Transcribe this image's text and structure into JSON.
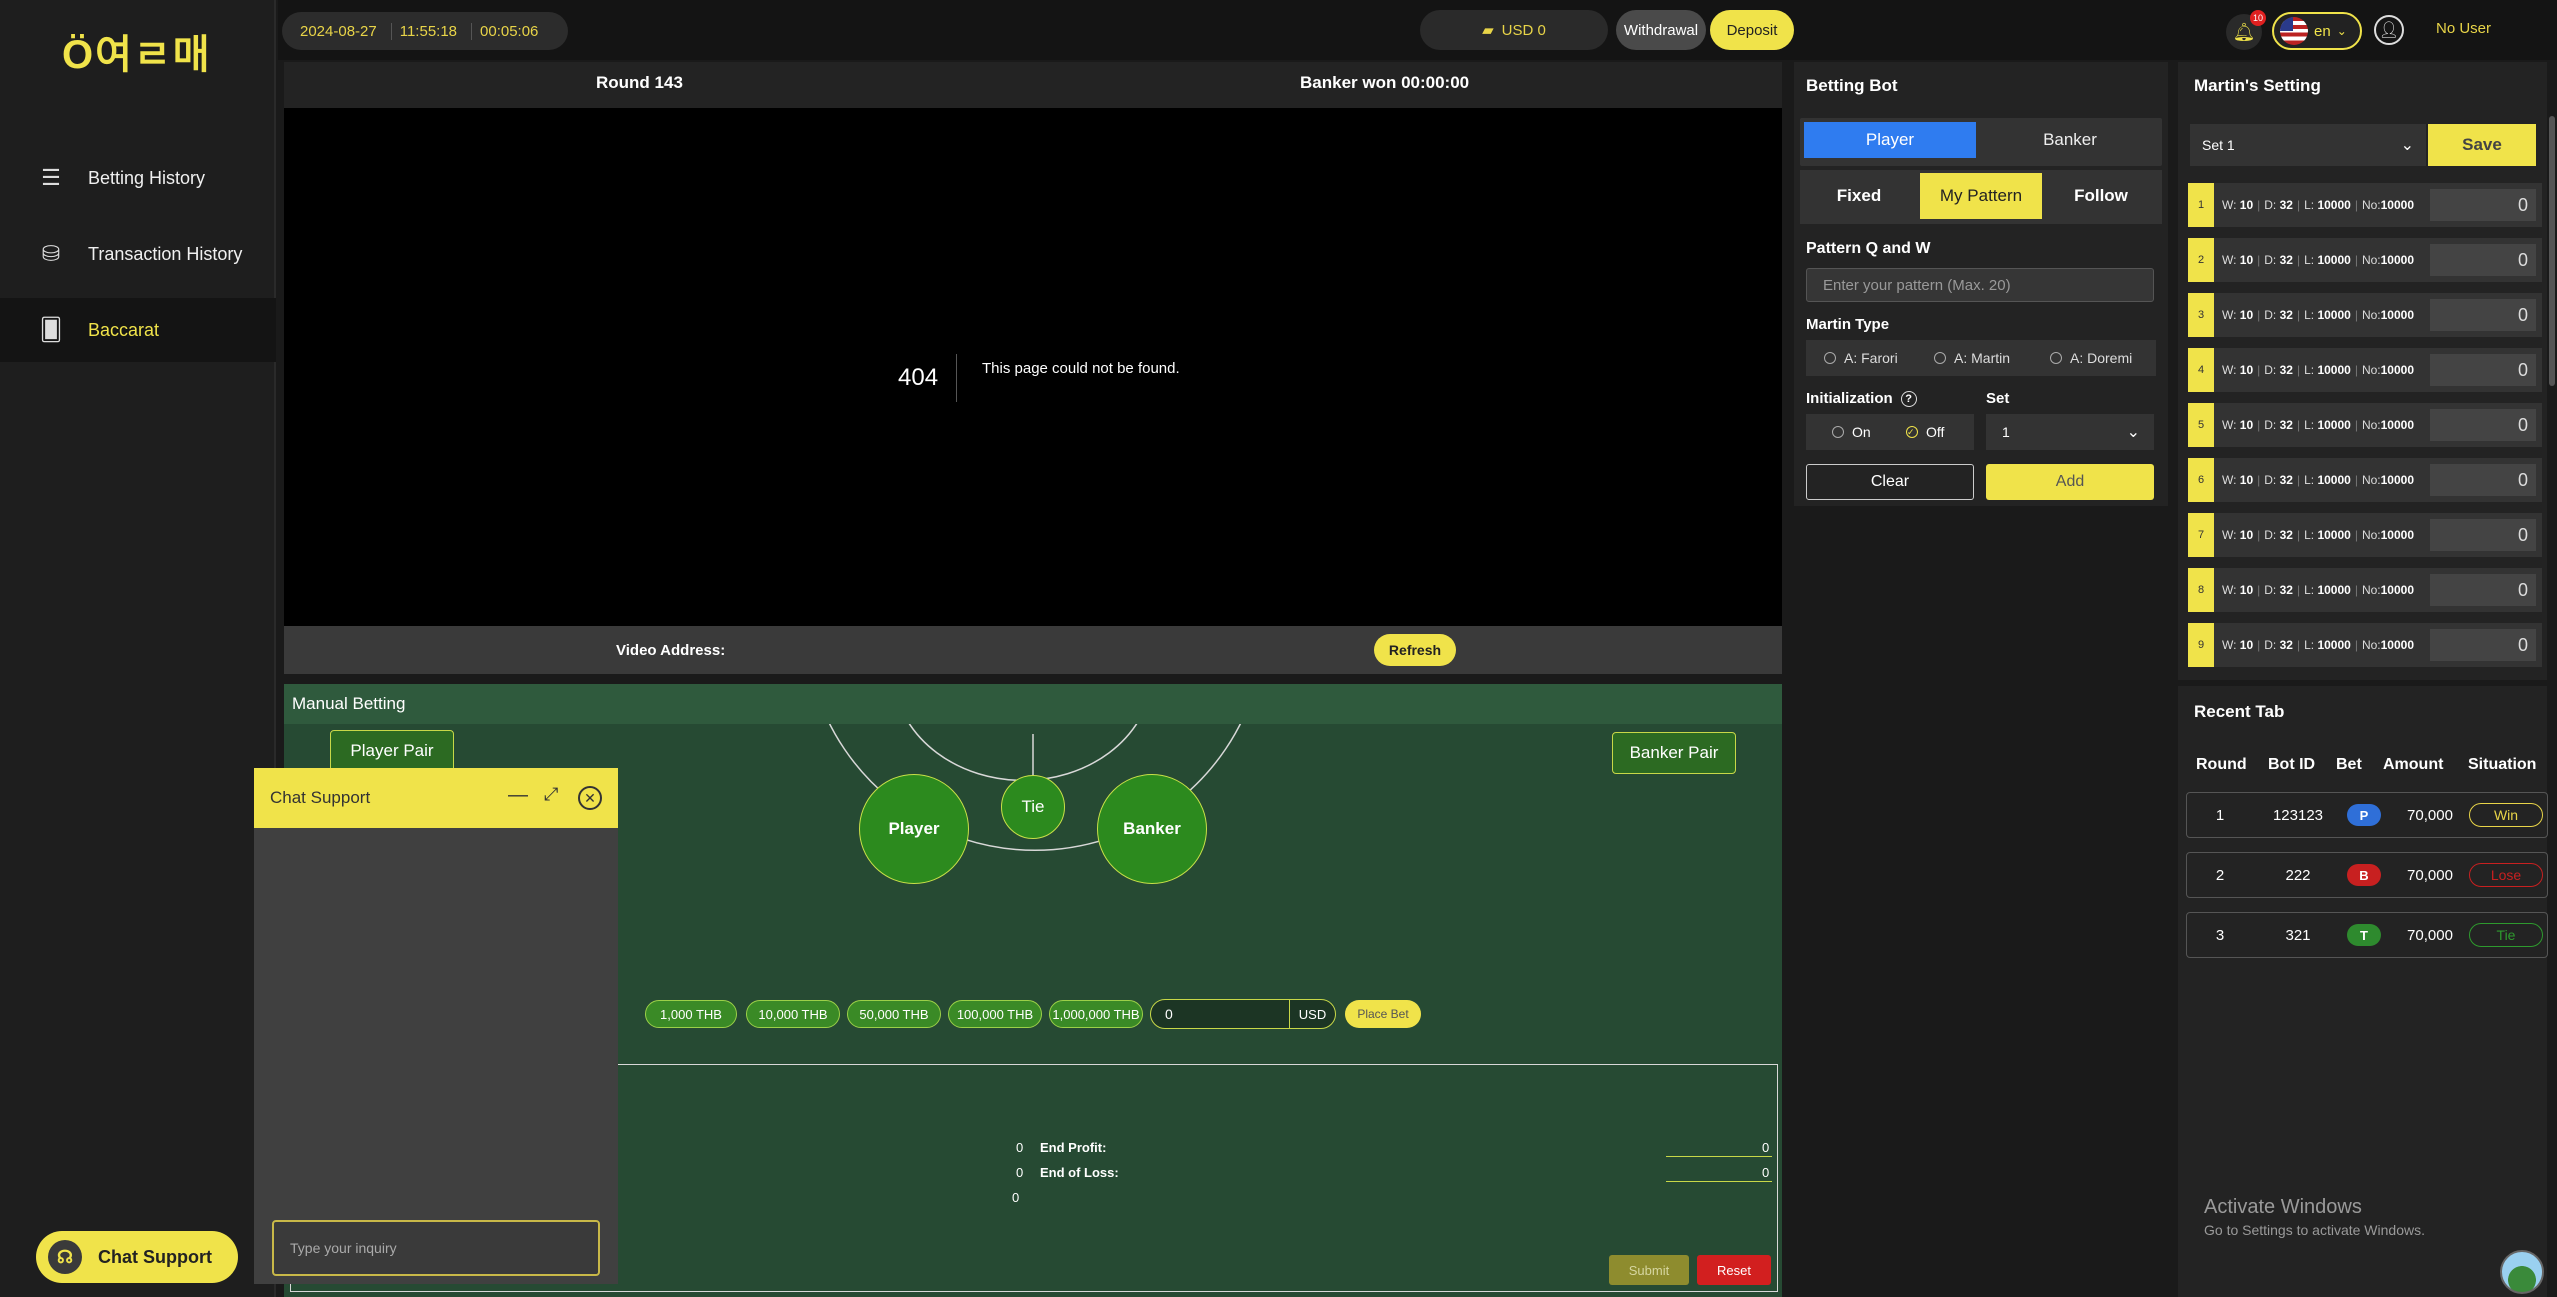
{
  "sidebar": {
    "logo": "Ö여ㄹ매",
    "items": [
      {
        "label": "Betting History",
        "icon": "list-icon"
      },
      {
        "label": "Transaction History",
        "icon": "coins-icon"
      },
      {
        "label": "Baccarat",
        "icon": "cards-icon"
      }
    ],
    "chat_support_label": "Chat Support"
  },
  "header": {
    "date": "2024-08-27",
    "time": "11:55:18",
    "elapsed": "00:05:06",
    "balance": "USD 0",
    "withdrawal_label": "Withdrawal",
    "deposit_label": "Deposit",
    "notification_count": "10",
    "language": "en",
    "user": "No User"
  },
  "video": {
    "round": "Round 143",
    "banker_won": "Banker won 00:00:00",
    "error_code": "404",
    "error_message": "This page could not be found.",
    "address_label": "Video Address:",
    "refresh_label": "Refresh"
  },
  "manual": {
    "title": "Manual Betting",
    "player_pair": "Player Pair",
    "banker_pair": "Banker Pair",
    "player": "Player",
    "tie": "Tie",
    "banker": "Banker",
    "chips": [
      "1,000 THB",
      "10,000 THB",
      "50,000 THB",
      "100,000 THB",
      "1,000,000 THB"
    ],
    "amount_value": "0",
    "amount_unit": "USD",
    "place_bet_label": "Place Bet",
    "left_values": [
      "0",
      "0",
      "0"
    ],
    "end_profit_label": "End Profit:",
    "end_loss_label": "End of Loss:",
    "end_profit_value": "0",
    "end_loss_value": "0",
    "submit_label": "Submit",
    "reset_label": "Reset"
  },
  "chat": {
    "title": "Chat Support",
    "input_placeholder": "Type your inquiry"
  },
  "bot": {
    "title": "Betting Bot",
    "side_tabs": [
      "Player",
      "Banker"
    ],
    "modes": [
      "Fixed",
      "My Pattern",
      "Follow"
    ],
    "pattern_label": "Pattern Q and W",
    "pattern_placeholder": "Enter your pattern (Max. 20)",
    "martin_type_label": "Martin Type",
    "martin_types": [
      "A: Farori",
      "A: Martin",
      "A: Doremi"
    ],
    "init_label": "Initialization",
    "init_options": [
      "On",
      "Off"
    ],
    "set_label": "Set",
    "set_value": "1",
    "clear_label": "Clear",
    "add_label": "Add",
    "colors": {
      "active_blue": "#2f7cf0",
      "accent_yellow": "#f0e34a"
    }
  },
  "martin": {
    "title": "Martin's Setting",
    "set_value": "Set 1",
    "save_label": "Save",
    "rows": [
      {
        "n": "1",
        "w": "10",
        "d": "32",
        "l": "10000",
        "no": "10000",
        "value": "0"
      },
      {
        "n": "2",
        "w": "10",
        "d": "32",
        "l": "10000",
        "no": "10000",
        "value": "0"
      },
      {
        "n": "3",
        "w": "10",
        "d": "32",
        "l": "10000",
        "no": "10000",
        "value": "0"
      },
      {
        "n": "4",
        "w": "10",
        "d": "32",
        "l": "10000",
        "no": "10000",
        "value": "0"
      },
      {
        "n": "5",
        "w": "10",
        "d": "32",
        "l": "10000",
        "no": "10000",
        "value": "0"
      },
      {
        "n": "6",
        "w": "10",
        "d": "32",
        "l": "10000",
        "no": "10000",
        "value": "0"
      },
      {
        "n": "7",
        "w": "10",
        "d": "32",
        "l": "10000",
        "no": "10000",
        "value": "0"
      },
      {
        "n": "8",
        "w": "10",
        "d": "32",
        "l": "10000",
        "no": "10000",
        "value": "0"
      },
      {
        "n": "9",
        "w": "10",
        "d": "32",
        "l": "10000",
        "no": "10000",
        "value": "0"
      }
    ]
  },
  "recent": {
    "title": "Recent Tab",
    "headers": [
      "Round",
      "Bot ID",
      "Bet",
      "Amount",
      "Situation"
    ],
    "rows": [
      {
        "round": "1",
        "bot_id": "123123",
        "bet": "P",
        "amount": "70,000",
        "situation": "Win",
        "bet_color": "#2f6fd8",
        "sit_color": "#e8d448"
      },
      {
        "round": "2",
        "bot_id": "222",
        "bet": "B",
        "amount": "70,000",
        "situation": "Lose",
        "bet_color": "#c82020",
        "sit_color": "#c82020"
      },
      {
        "round": "3",
        "bot_id": "321",
        "bet": "T",
        "amount": "70,000",
        "situation": "Tie",
        "bet_color": "#2e8a2e",
        "sit_color": "#2e9a2e"
      }
    ]
  },
  "watermark": {
    "line1": "Activate Windows",
    "line2": "Go to Settings to activate Windows."
  }
}
